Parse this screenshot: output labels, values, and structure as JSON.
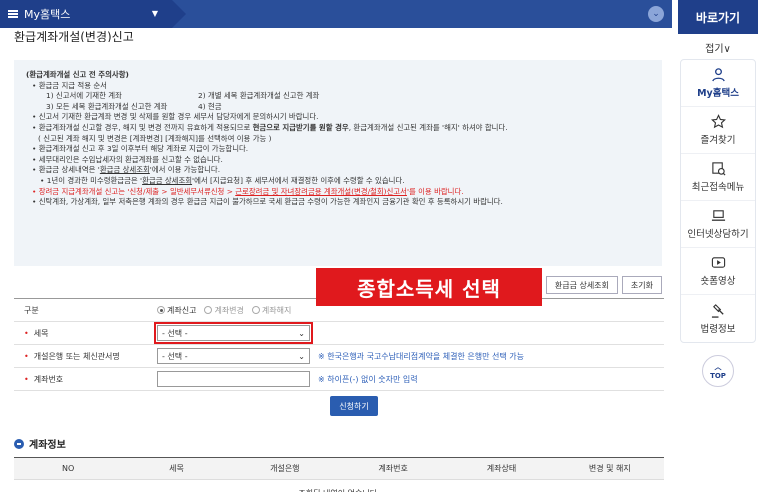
{
  "topbar": {
    "menu_label": "My홈택스"
  },
  "quick": {
    "title": "바로가기",
    "fold": "접기∨",
    "items": [
      {
        "label": "My홈택스",
        "icon": "person-icon"
      },
      {
        "label": "즐겨찾기",
        "icon": "star-icon"
      },
      {
        "label": "최근접속메뉴",
        "icon": "recent-menu-icon"
      },
      {
        "label": "인터넷상담하기",
        "icon": "laptop-icon"
      },
      {
        "label": "숏폼영상",
        "icon": "play-icon"
      },
      {
        "label": "법령정보",
        "icon": "gavel-icon"
      }
    ],
    "top": "TOP"
  },
  "page_title": "환급계좌개설(변경)신고",
  "notice": {
    "title": "(환급계좌개설 신고 전 주의사항)",
    "l1": "• 환급금 지급 적용 순서",
    "o1": "1) 신고서에 기재한 계좌",
    "o2": "2) 개별 세목 환급계좌개설 신고한 계좌",
    "o3": "3) 모든 세목 환급계좌개설 신고한 계좌",
    "o4": "4) 현금",
    "l2": "• 신고서 기재한 환급계좌 변경 및 삭제를 원할 경우 세무서 담당자에게 문의하시기 바랍니다.",
    "l3a": "• 환급계좌개설 신고할 경우, 해지 및 변경 전까지 유효하게 적용되므로 ",
    "l3b": "현금으로 지급받기를 원할 경우",
    "l3c": ", 환급계좌개설 신고된 계좌를 '해지' 하셔야 합니다.",
    "l4": "( 신고된 계좌 해지 및 변경은 [계좌변경] [계좌해지]를 선택하여 이용 가능 )",
    "l5": "• 환급계좌개설 신고 후 3일 이후부터 해당 계좌로 지급이 가능합니다.",
    "l6": "• 세무대리인은 수임납세자의 환급계좌를 신고할 수 없습니다.",
    "l7a": "• 환급금 상세내역은 '",
    "l7b": "환급금 상세조회",
    "l7c": "'에서 이용 가능합니다.",
    "l8a": "• 1년이 경과한 미수령환급금은 '",
    "l8b": "환급금 상세조회",
    "l8c": "'에서 [지급요청] 후 세무서에서 재결정한 이후에 수령할 수 있습니다.",
    "l9a": "• 장려금 지급계좌개설 신고는 '신청/제출 > 일반세무서류신청 > ",
    "l9b": "근로장려금 및 자녀장려금용 계좌개설(변경/철회)신고서",
    "l9c": "'를 이용 바랍니다.",
    "l10": "• 신탁계좌, 가상계좌, 일부 저축은행 계좌의 경우 환급금 지급이 불가하므로 국세 환급금 수령이 가능한 계좌인지 금융기관 확인 후 등록하시기 바랍니다."
  },
  "buttons": {
    "refund_detail": "환급금 상세조회",
    "reset": "초기화",
    "submit": "신청하기"
  },
  "form": {
    "type_label": "구분",
    "type_options": [
      "계좌신고",
      "계좌변경",
      "계좌해지"
    ],
    "tax_label": "세목",
    "tax_value": "- 선택 -",
    "bank_label": "개설은행 또는 체신관서명",
    "bank_value": "- 선택 -",
    "bank_hint": "※ 한국은행과 국고수납대리점계약을 체결한 은행만 선택 가능",
    "acct_label": "계좌번호",
    "acct_hint": "※ 하이픈(-) 없이 숫자만 입력"
  },
  "overlay_text": "종합소득세 선택",
  "account_section": {
    "title": "계좌정보",
    "headers": [
      "NO",
      "세목",
      "개설은행",
      "계좌번호",
      "계좌상태",
      "변경 및 해지"
    ],
    "empty": "조회된 내역이 없습니다."
  }
}
